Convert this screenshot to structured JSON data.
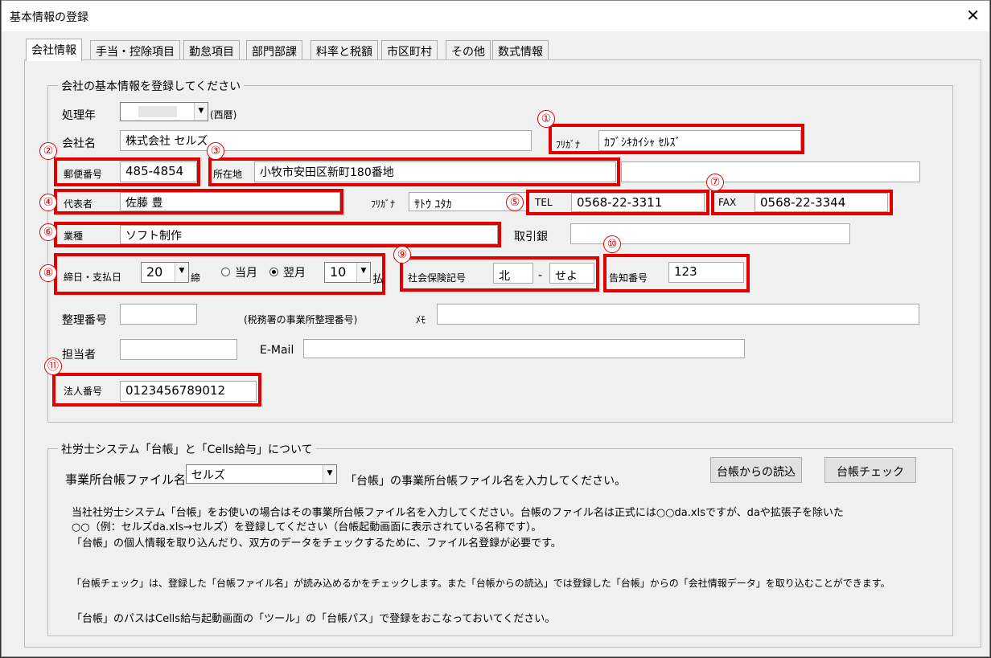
{
  "window": {
    "title": "基本情報の登録"
  },
  "tabs": [
    "会社情報",
    "手当・控除項目",
    "勤怠項目",
    "部門部課",
    "料率と税額",
    "市区町村",
    "その他",
    "数式情報"
  ],
  "group1": {
    "legend": "会社の基本情報を登録してください",
    "fiscal_year": {
      "label": "処理年",
      "suffix": "(西暦)"
    },
    "company": {
      "label": "会社名",
      "value": "株式会社 セルズ"
    },
    "furigana_company": {
      "label": "ﾌﾘｶﾞﾅ",
      "value": "ｶﾌﾞｼｷｶｲｼｬ ｾﾙｽﾞ"
    },
    "postal": {
      "label": "郵便番号",
      "value": "485-4854"
    },
    "address": {
      "label": "所在地",
      "value": "小牧市安田区新町180番地",
      "value2": ""
    },
    "rep": {
      "label": "代表者",
      "value": "佐藤 豊"
    },
    "furigana_rep": {
      "label": "ﾌﾘｶﾞﾅ",
      "value": "ｻﾄｳ ﾕﾀｶ"
    },
    "tel": {
      "label": "TEL",
      "value": "0568-22-3311"
    },
    "fax": {
      "label": "FAX",
      "value": "0568-22-3344"
    },
    "industry": {
      "label": "業種",
      "value": "ソフト制作"
    },
    "bank": {
      "label": "取引銀",
      "value": ""
    },
    "closing": {
      "label": "締日・支払日",
      "closing_day": "20",
      "closing_suffix": "締",
      "radio_this": "当月",
      "radio_next": "翌月",
      "pay_day": "10",
      "pay_suffix": "払"
    },
    "social": {
      "label": "社会保険記号",
      "value1": "北",
      "dash": "-",
      "value2": "せよ"
    },
    "notice": {
      "label": "告知番号",
      "value": "123"
    },
    "ref": {
      "label": "整理番号",
      "value": "",
      "note": "(税務署の事業所整理番号)"
    },
    "memo": {
      "label": "ﾒﾓ",
      "value": ""
    },
    "person": {
      "label": "担当者",
      "value": ""
    },
    "email": {
      "label": "E-Mail",
      "value": ""
    },
    "corp_no": {
      "label": "法人番号",
      "value": "0123456789012"
    }
  },
  "markers": [
    "①",
    "②",
    "③",
    "④",
    "⑤",
    "⑥",
    "⑦",
    "⑧",
    "⑨",
    "⑩",
    "⑪"
  ],
  "group2": {
    "legend": "社労士システム「台帳」と「Cells給与」について",
    "file_label": "事業所台帳ファイル名",
    "file_value": "セルズ",
    "file_hint": "「台帳」の事業所台帳ファイル名を入力してください。",
    "btn_read": "台帳からの読込",
    "btn_check": "台帳チェック",
    "notes": [
      "当社社労士システム「台帳」をお使いの場合はその事業所台帳ファイル名を入力してください。台帳のファイル名は正式には○○da.xlsですが、daや拡張子を除いた",
      "○○（例：セルズda.xls→セルズ）を登録してください（台帳起動画面に表示されている名称です）。",
      "「台帳」の個人情報を取り込んだり、双方のデータをチェックするために、ファイル名登録が必要です。",
      "「台帳チェック」は、登録した「台帳ファイル名」が読み込めるかをチェックします。また「台帳からの読込」では登録した「台帳」からの「会社情報データ」を取り込むことができます。",
      "「台帳」のパスはCells給与起動画面の「ツール」の「台帳パス」で登録をおこなっておいてください。"
    ]
  }
}
